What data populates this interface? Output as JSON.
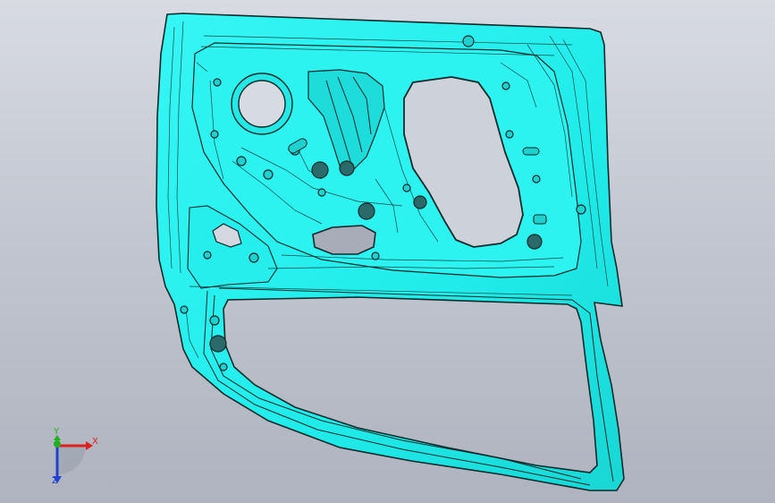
{
  "viewport": {
    "background_top": "#d8dbe3",
    "background_bottom": "#aeb3bf"
  },
  "model": {
    "fill_color": "#20f0ee",
    "edge_color": "#0a2a2a",
    "shadow_color": "#15b3b2"
  },
  "triad": {
    "x_label": "X",
    "y_label": "Y",
    "z_label": "Z",
    "x_color": "#e02020",
    "y_color": "#20b020",
    "z_color": "#2040d0"
  }
}
